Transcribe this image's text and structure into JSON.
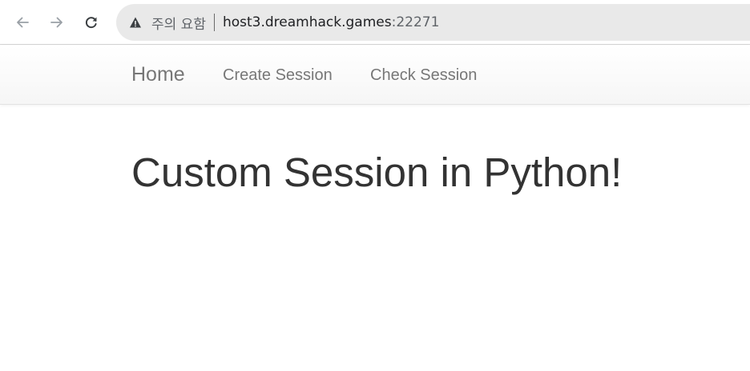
{
  "browser": {
    "security_warning": "주의 요함",
    "url_host": "host3.dreamhack.games",
    "url_port": ":22271"
  },
  "navbar": {
    "brand": "Home",
    "links": [
      "Create Session",
      "Check Session"
    ]
  },
  "main": {
    "title": "Custom Session in Python!"
  }
}
